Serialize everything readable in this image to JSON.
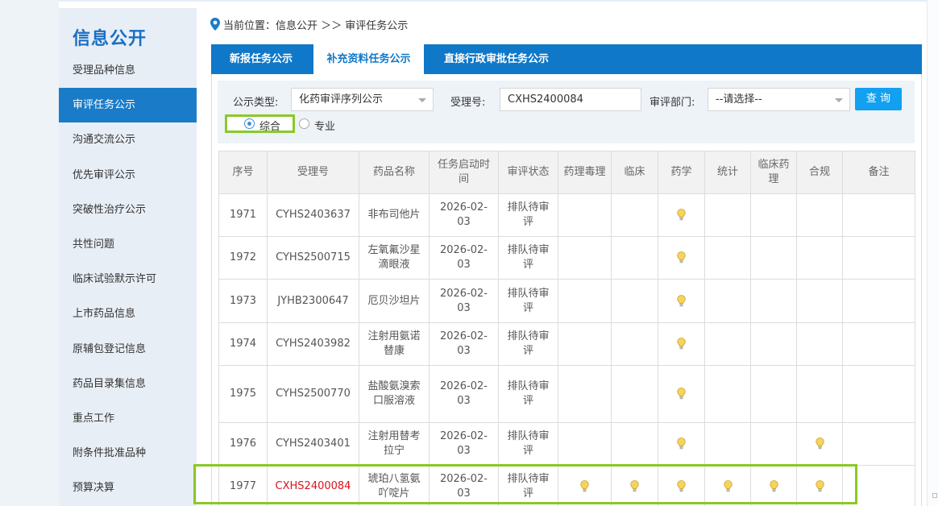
{
  "sidebar": {
    "title": "信息公开",
    "items": [
      {
        "label": "受理品种信息",
        "active": false
      },
      {
        "label": "审评任务公示",
        "active": true
      },
      {
        "label": "沟通交流公示",
        "active": false
      },
      {
        "label": "优先审评公示",
        "active": false
      },
      {
        "label": "突破性治疗公示",
        "active": false
      },
      {
        "label": "共性问题",
        "active": false
      },
      {
        "label": "临床试验默示许可",
        "active": false
      },
      {
        "label": "上市药品信息",
        "active": false
      },
      {
        "label": "原辅包登记信息",
        "active": false
      },
      {
        "label": "药品目录集信息",
        "active": false
      },
      {
        "label": "重点工作",
        "active": false
      },
      {
        "label": "附条件批准品种",
        "active": false
      },
      {
        "label": "预算决算",
        "active": false
      }
    ]
  },
  "breadcrumb": {
    "text": "当前位置：信息公开 ＞＞ 审评任务公示"
  },
  "tabs": [
    {
      "label": "新报任务公示",
      "active": false
    },
    {
      "label": "补充资料任务公示",
      "active": true
    },
    {
      "label": "直接行政审批任务公示",
      "active": false
    }
  ],
  "filter": {
    "type_label": "公示类型:",
    "type_value": "化药审评序列公示",
    "accept_label": "受理号:",
    "accept_value": "CXHS2400084",
    "dept_label": "审评部门:",
    "dept_value": "--请选择--",
    "query_button": "查 询",
    "radio_1": "综合",
    "radio_2": "专业",
    "radio_selected": "综合"
  },
  "table": {
    "headers": [
      "序号",
      "受理号",
      "药品名称",
      "任务启动时间",
      "审评状态",
      "药理毒理",
      "临床",
      "药学",
      "统计",
      "临床药理",
      "合规",
      "备注"
    ],
    "rows": [
      {
        "no": "1971",
        "accept": "CYHS2403637",
        "drug": "非布司他片",
        "date": "2026-02-03",
        "status": "排队待审评",
        "highlight": false,
        "marks": [
          false,
          false,
          true,
          false,
          false,
          false
        ]
      },
      {
        "no": "1972",
        "accept": "CYHS2500715",
        "drug": "左氧氟沙星滴眼液",
        "date": "2026-02-03",
        "status": "排队待审评",
        "highlight": false,
        "marks": [
          false,
          false,
          true,
          false,
          false,
          false
        ]
      },
      {
        "no": "1973",
        "accept": "JYHB2300647",
        "drug": "厄贝沙坦片",
        "date": "2026-02-03",
        "status": "排队待审评",
        "highlight": false,
        "marks": [
          false,
          false,
          true,
          false,
          false,
          false
        ]
      },
      {
        "no": "1974",
        "accept": "CYHS2403982",
        "drug": "注射用氨诺替康",
        "date": "2026-02-03",
        "status": "排队待审评",
        "highlight": false,
        "marks": [
          false,
          false,
          true,
          false,
          false,
          false
        ]
      },
      {
        "no": "1975",
        "accept": "CYHS2500770",
        "drug": "盐酸氨溴索口服溶液",
        "date": "2026-02-03",
        "status": "排队待审评",
        "highlight": false,
        "marks": [
          false,
          false,
          true,
          false,
          false,
          false
        ]
      },
      {
        "no": "1976",
        "accept": "CYHS2403401",
        "drug": "注射用替考拉宁",
        "date": "2026-02-03",
        "status": "排队待审评",
        "highlight": false,
        "marks": [
          false,
          false,
          true,
          false,
          false,
          true
        ]
      },
      {
        "no": "1977",
        "accept": "CXHS2400084",
        "drug": "琥珀八氢氨吖啶片",
        "date": "2026-02-03",
        "status": "排队待审评",
        "highlight": true,
        "marks": [
          true,
          true,
          true,
          true,
          true,
          true
        ]
      }
    ]
  },
  "colors": {
    "brand": "#1a7cc9",
    "tabbar": "#0f78c8",
    "highlight_text": "#d9141f",
    "annotation_box": "#8ac926",
    "query_button": "#12a1f0"
  },
  "icons": {
    "location": "location-pin-icon",
    "bulb": "lightbulb-icon"
  }
}
